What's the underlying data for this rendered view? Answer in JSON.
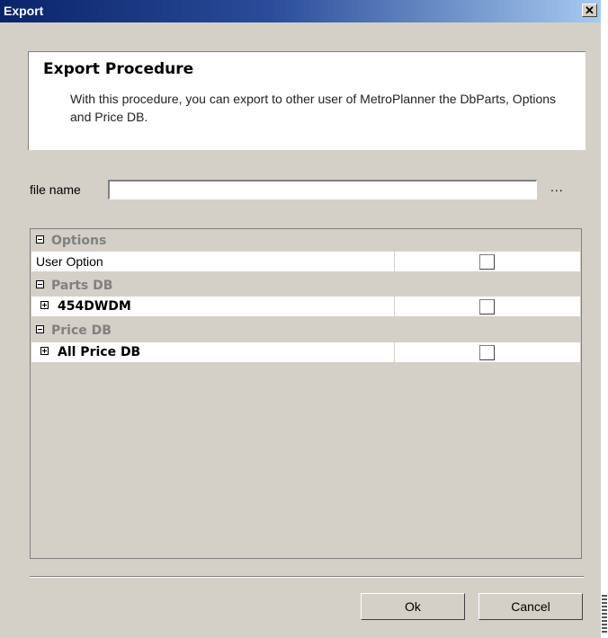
{
  "window": {
    "title": "Export",
    "close_label": "✕"
  },
  "header": {
    "title": "Export Procedure",
    "description": "With this procedure, you can export to other user of MetroPlanner the DbParts, Options and Price DB."
  },
  "file": {
    "label": "file name",
    "value": "",
    "browse_label": "..."
  },
  "tree": {
    "categories": [
      {
        "label": "Options",
        "expanded": true,
        "items": [
          {
            "label": "User Option",
            "expandable": false,
            "bold": false,
            "checked": false
          }
        ]
      },
      {
        "label": "Parts DB",
        "expanded": true,
        "items": [
          {
            "label": "454DWDM",
            "expandable": true,
            "bold": true,
            "checked": false
          }
        ]
      },
      {
        "label": "Price DB",
        "expanded": true,
        "items": [
          {
            "label": "All Price DB",
            "expandable": true,
            "bold": true,
            "checked": false
          }
        ]
      }
    ]
  },
  "buttons": {
    "ok_label": "Ok",
    "cancel_label": "Cancel"
  },
  "colors": {
    "title_start": "#0a246a",
    "title_end": "#a6caf0",
    "dialog_bg": "#d4d0c8"
  }
}
